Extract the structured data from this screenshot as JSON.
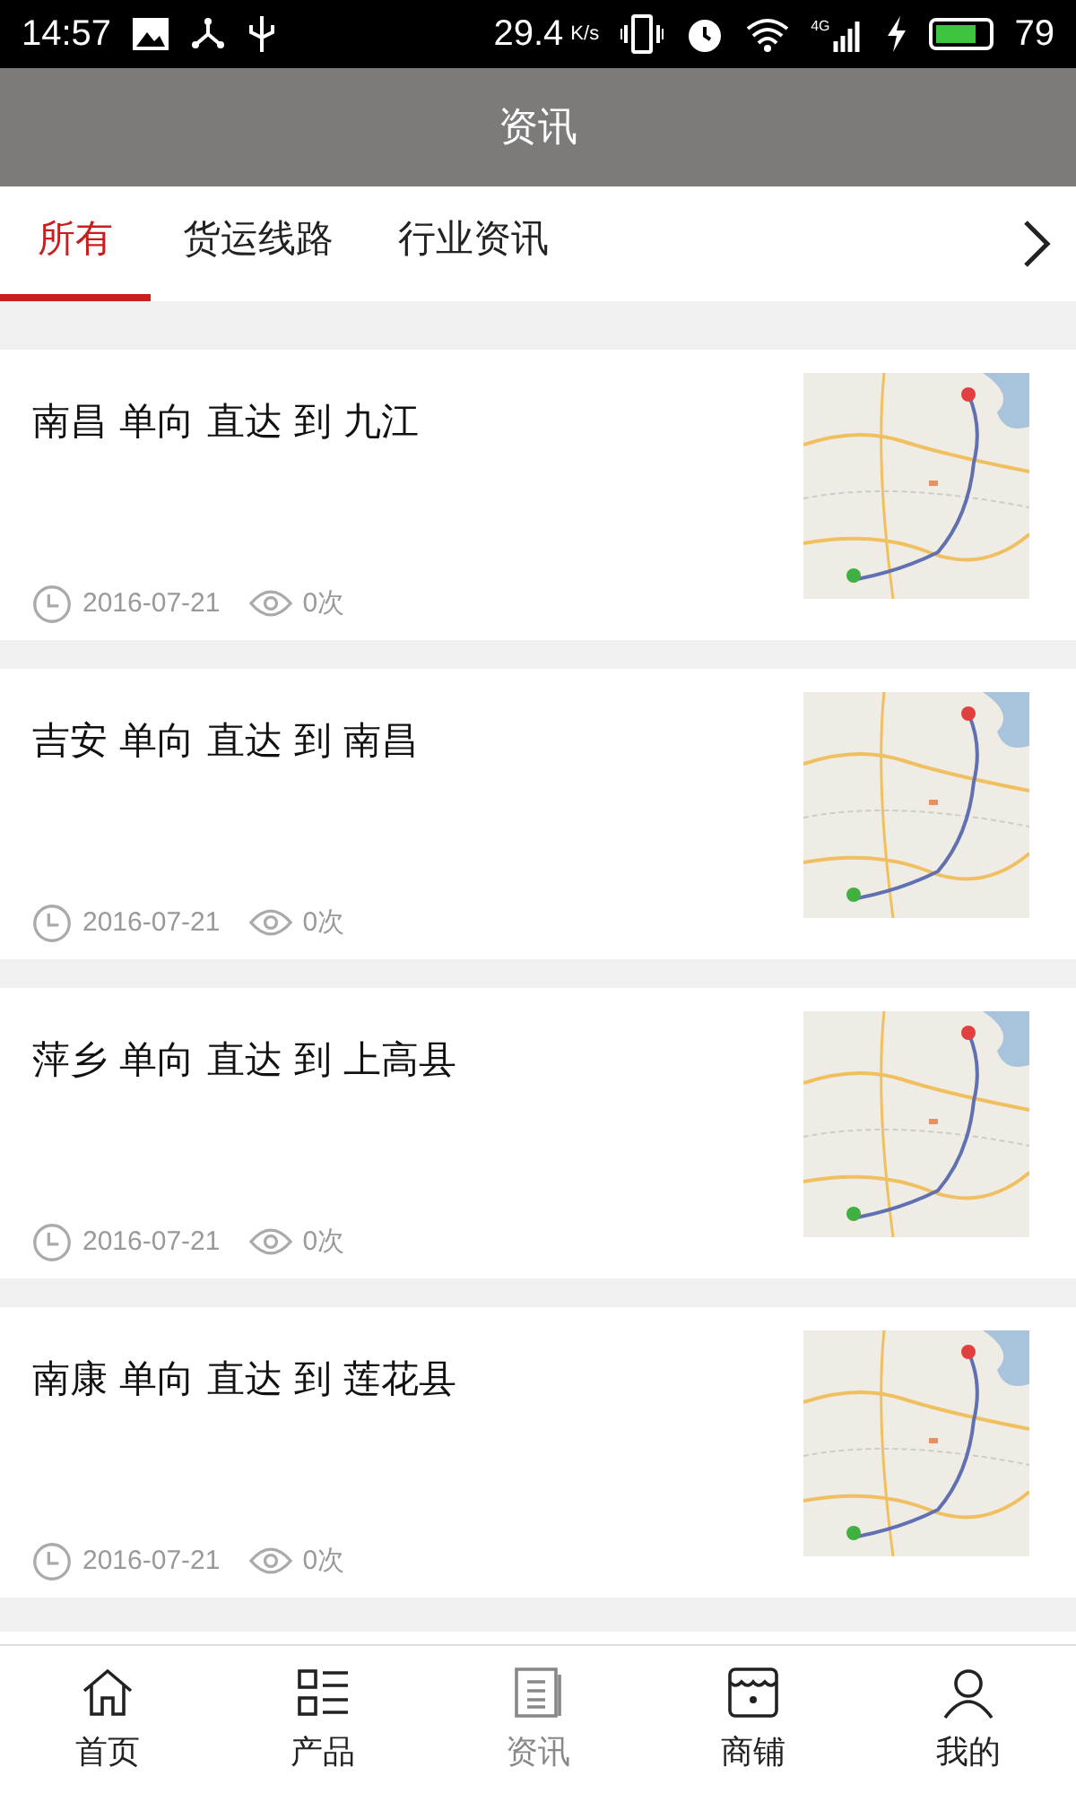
{
  "status_bar": {
    "time": "14:57",
    "speed": "29.4",
    "speed_unit": "K/s",
    "network": "4G",
    "battery": "79"
  },
  "header": {
    "title": "资讯"
  },
  "tabs": [
    {
      "label": "所有",
      "selected": true
    },
    {
      "label": "货运线路",
      "selected": false
    },
    {
      "label": "行业资讯",
      "selected": false
    }
  ],
  "articles": [
    {
      "title": "南昌 单向 直达 到 九江",
      "date": "2016-07-21",
      "views": "0次"
    },
    {
      "title": "吉安 单向 直达 到 南昌",
      "date": "2016-07-21",
      "views": "0次"
    },
    {
      "title": "萍乡 单向 直达 到 上高县",
      "date": "2016-07-21",
      "views": "0次"
    },
    {
      "title": "南康 单向 直达 到 莲花县",
      "date": "2016-07-21",
      "views": "0次"
    }
  ],
  "bottom_nav": [
    {
      "label": "首页",
      "kind": "home",
      "selected": false
    },
    {
      "label": "产品",
      "kind": "list",
      "selected": false
    },
    {
      "label": "资讯",
      "kind": "news",
      "selected": true
    },
    {
      "label": "商铺",
      "kind": "shop",
      "selected": false
    },
    {
      "label": "我的",
      "kind": "user",
      "selected": false
    }
  ]
}
